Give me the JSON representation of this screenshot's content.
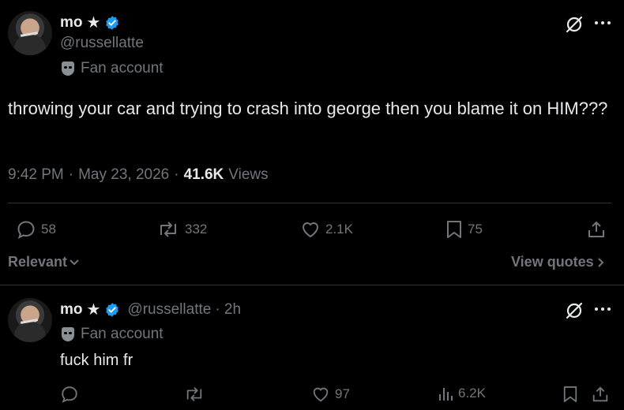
{
  "tweet": {
    "author_name": "mo",
    "author_star": "★",
    "handle": "@russellatte",
    "affiliation_label": "Fan account",
    "text": "throwing your car and trying to crash into george then you blame it on HIM???",
    "time": "9:42 PM",
    "date": "May 23, 2026",
    "separator": "·",
    "views_count": "41.6K",
    "views_label": "Views",
    "replies": "58",
    "reposts": "332",
    "likes": "2.1K",
    "bookmarks": "75"
  },
  "sort": {
    "label": "Relevant",
    "view_quotes": "View quotes"
  },
  "reply": {
    "author_name": "mo",
    "author_star": "★",
    "handle": "@russellatte",
    "age": "· 2h",
    "affiliation_label": "Fan account",
    "text": "fuck him fr",
    "likes": "97",
    "views": "6.2K"
  },
  "colors": {
    "background": "#000000",
    "text": "#e7e9ea",
    "muted": "#71767b",
    "verified": "#1d9bf0",
    "divider": "#2f3336"
  }
}
